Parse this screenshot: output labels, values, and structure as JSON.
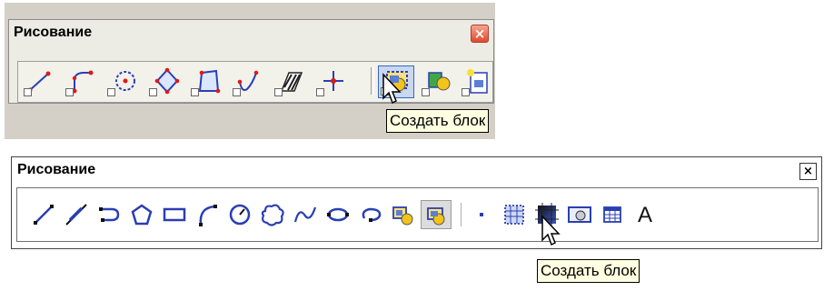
{
  "toolbar_top": {
    "title": "Рисование",
    "close_glyph": "×",
    "tools": [
      {
        "name": "line-icon"
      },
      {
        "name": "polyline-icon"
      },
      {
        "name": "circle-icon"
      },
      {
        "name": "polygon-icon"
      },
      {
        "name": "rectangle-icon"
      },
      {
        "name": "spline-icon"
      },
      {
        "name": "hatch-icon"
      },
      {
        "name": "point-icon"
      },
      {
        "name": "create-block-icon"
      },
      {
        "name": "insert-block-icon"
      },
      {
        "name": "write-block-icon"
      }
    ],
    "tooltip": "Создать блок",
    "accent": "#3169c6",
    "close_color": "#e04a2f"
  },
  "toolbar_bottom": {
    "title": "Рисование",
    "close_glyph": "×",
    "tools": [
      {
        "name": "line-icon"
      },
      {
        "name": "construction-line-icon"
      },
      {
        "name": "polyline-icon"
      },
      {
        "name": "polygon-icon"
      },
      {
        "name": "rectangle-icon"
      },
      {
        "name": "arc-icon"
      },
      {
        "name": "circle-icon"
      },
      {
        "name": "revision-cloud-icon"
      },
      {
        "name": "spline-icon"
      },
      {
        "name": "ellipse-icon"
      },
      {
        "name": "ellipse-arc-icon"
      },
      {
        "name": "insert-block-icon"
      },
      {
        "name": "create-block-icon"
      },
      {
        "name": "point-icon"
      },
      {
        "name": "hatch-icon"
      },
      {
        "name": "gradient-icon"
      },
      {
        "name": "region-icon"
      },
      {
        "name": "table-icon"
      },
      {
        "name": "text-icon"
      }
    ],
    "text_tool_glyph": "A",
    "tooltip": "Создать блок"
  }
}
